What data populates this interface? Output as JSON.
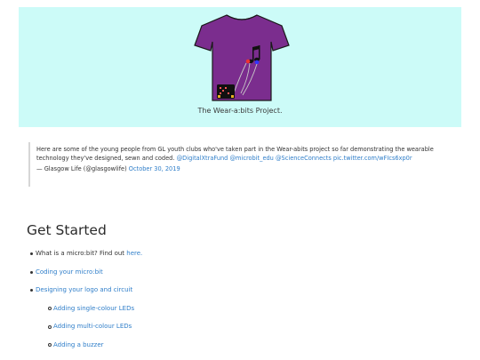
{
  "hero": {
    "caption": "The Wear-a:bits Project.",
    "shirt_color": "#7b2d8e",
    "background": "#ccfbf8"
  },
  "quote": {
    "text": "Here are some of the young people from GL youth clubs who've taken part in the Wear-abits project so far demonstrating the wearable technology they've designed, sewn and coded.",
    "handles": "@DigitalXtraFund @microbit_edu @ScienceConnects pic.twitter.com/wFIcs6xp0r",
    "attribution": "— Glasgow Life (@glasgowlife)",
    "date": "October 30, 2019"
  },
  "section": {
    "title": "Get Started"
  },
  "list": {
    "item0_text": "What is a micro:bit? Find out ",
    "item0_link": "here.",
    "item1": "Coding your micro:bit",
    "item2": "Designing your logo and circuit",
    "item3": "Adding single-colour LEDs",
    "item4": "Adding multi-colour LEDs",
    "item5": "Adding a buzzer"
  },
  "colors": {
    "link": "#2f7ec9"
  }
}
